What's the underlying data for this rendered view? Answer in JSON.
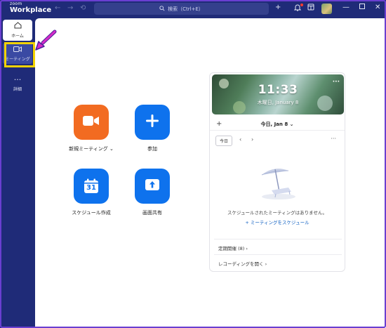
{
  "titlebar": {
    "brand_small": "zoom",
    "brand_big": "Workplace",
    "search_placeholder": "検索（Ctrl+E）"
  },
  "sidebar": {
    "items": [
      {
        "label": "ホーム",
        "icon": "home-icon"
      },
      {
        "label": "ミーティング",
        "icon": "video-icon"
      },
      {
        "label": "詳細",
        "icon": "more-icon"
      }
    ]
  },
  "tiles": [
    {
      "label": "新規ミーティング",
      "icon": "video-camera-icon",
      "color": "#f26b21",
      "has_dropdown": true
    },
    {
      "label": "参加",
      "icon": "plus-icon",
      "color": "#0e72ed"
    },
    {
      "label": "スケジュール作成",
      "icon": "calendar-icon",
      "color": "#0e72ed",
      "calendar_day": "31"
    },
    {
      "label": "画面共有",
      "icon": "share-screen-icon",
      "color": "#0e72ed"
    }
  ],
  "calendar_panel": {
    "time": "11:33",
    "date": "木曜日, January 8",
    "day_selector": "今日, Jan 8",
    "today_button": "今日",
    "empty_message": "スケジュールされたミーティングはありません。",
    "schedule_link": "ミーティングをスケジュール",
    "rows": [
      "定期開催 (8)",
      "レコーディングを開く"
    ]
  },
  "colors": {
    "sidebar_bg": "#1f2b78",
    "accent_blue": "#0e72ed",
    "accent_orange": "#f26b21",
    "highlight": "#f1d200",
    "annotation_arrow": "#d62cc7"
  }
}
